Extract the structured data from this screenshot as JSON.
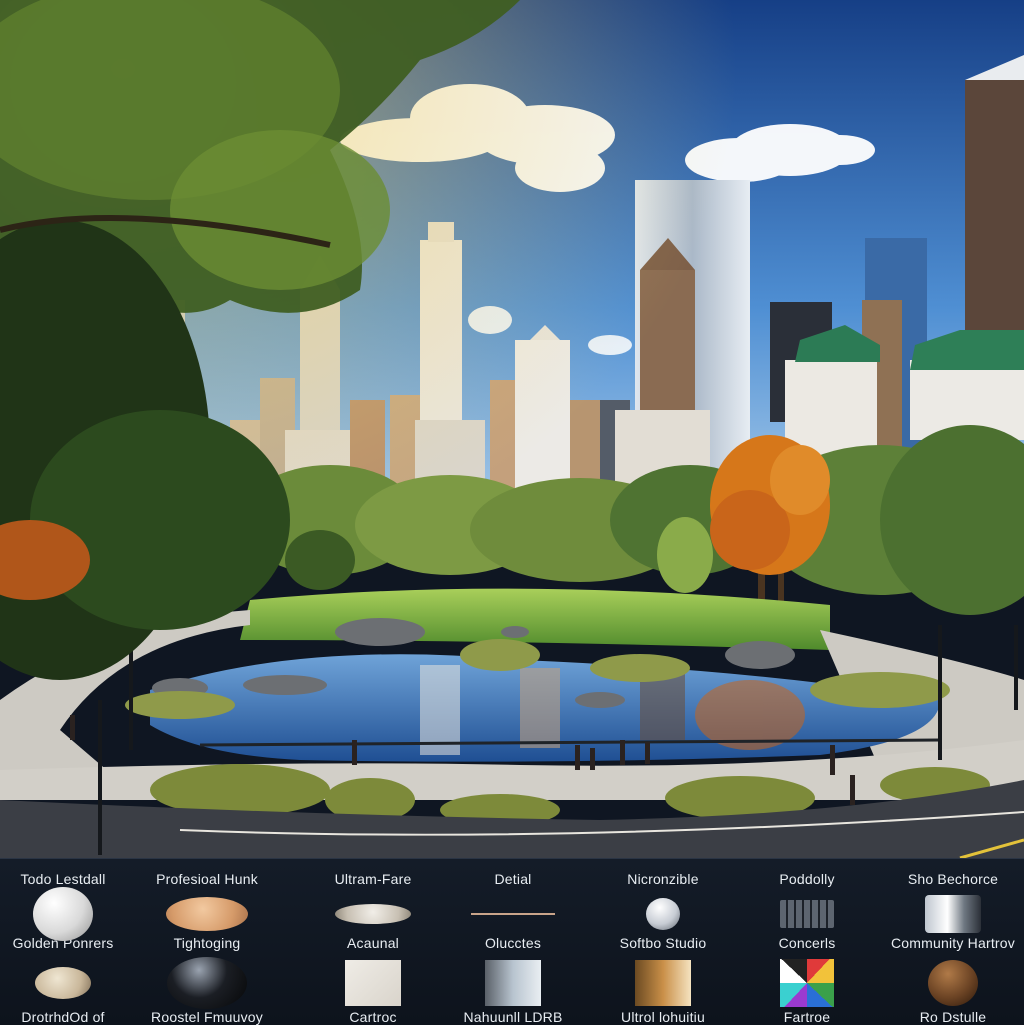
{
  "scene": {
    "colors": {
      "sky_top": "#1b4f9a",
      "sky_bottom": "#9fc6ea",
      "grass": "#79b13f",
      "water": "#2e6fb8",
      "path": "#c9c6bf",
      "road": "#3a3d44",
      "autumn": "#d6771a"
    }
  },
  "swatch_panel": {
    "columns": [
      {
        "top_label": "Todo Lestdall",
        "mid_label": "Golden Ponrers",
        "bottom_label": "DrotrhdOd of",
        "top_icon": "white-sphere-icon",
        "bottom_icon": "beige-ellipse-icon"
      },
      {
        "top_label": "Profesioal Hunk",
        "mid_label": "Tightoging",
        "bottom_label": "Roostel Fmuuvoy",
        "top_icon": "tan-ellipse-icon",
        "bottom_icon": "black-sphere-icon"
      },
      {
        "top_label": "Ultram-Fare",
        "mid_label": "Acaunal",
        "bottom_label": "Cartroc",
        "top_icon": "flat-disc-icon",
        "bottom_icon": "canvas-square-icon"
      },
      {
        "top_label": "Detial",
        "mid_label": "Olucctes",
        "bottom_label": "Nahuunll LDRB",
        "top_icon": "thin-line-icon",
        "bottom_icon": "gradient-square-icon"
      },
      {
        "top_label": "Nicronzible",
        "mid_label": "Softbo Studio",
        "bottom_label": "Ultrol lohuitiu",
        "top_icon": "small-sphere-icon",
        "bottom_icon": "gold-gradient-icon"
      },
      {
        "top_label": "Poddolly",
        "mid_label": "Concerls",
        "bottom_label": "Fartroe",
        "top_icon": "grid-panel-icon",
        "bottom_icon": "color-checker-icon"
      },
      {
        "top_label": "Sho Bechorce",
        "mid_label": "Community Hartrov",
        "bottom_label": "Ro Dstulle",
        "top_icon": "camera-lens-icon",
        "bottom_icon": "brown-sphere-icon"
      }
    ]
  }
}
